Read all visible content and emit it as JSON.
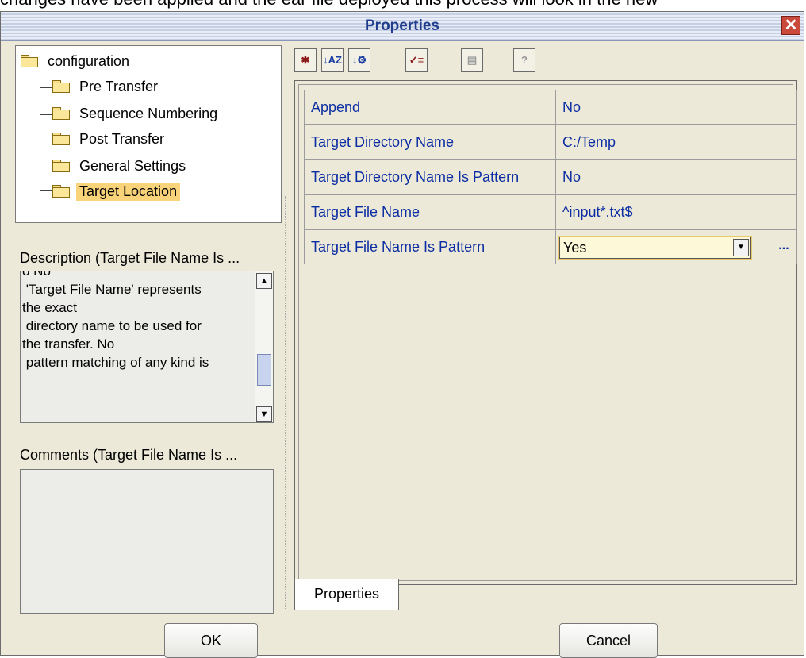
{
  "background_text": "changes have been applied and the ear file deployed this process will look in the new",
  "dialog": {
    "title": "Properties",
    "close_glyph": "✕"
  },
  "tree": {
    "root": "configuration",
    "items": [
      {
        "label": "Pre Transfer"
      },
      {
        "label": "Sequence Numbering"
      },
      {
        "label": "Post Transfer"
      },
      {
        "label": "General Settings"
      },
      {
        "label": "Target Location",
        "selected": true
      }
    ]
  },
  "description": {
    "label": "Description (Target File Name Is ...",
    "text": "o No\n 'Target File Name' represents\nthe exact\n directory name to be used for\nthe transfer. No\n pattern matching of any kind is"
  },
  "comments": {
    "label": "Comments (Target File Name Is ..."
  },
  "toolbar": {
    "buttons": [
      {
        "icon": "categorized-icon",
        "glyph": "✱"
      },
      {
        "icon": "sort-alphabetic-icon",
        "glyph": "↓AZ"
      },
      {
        "icon": "sort-by-category-icon",
        "glyph": "↓⚙"
      },
      {
        "icon": "show-modified-icon",
        "glyph": "✓≡"
      },
      {
        "icon": "property-pages-icon",
        "glyph": "▤"
      },
      {
        "icon": "help-icon",
        "glyph": "?"
      }
    ]
  },
  "properties": {
    "rows": [
      {
        "name": "Append",
        "value": "No"
      },
      {
        "name": "Target Directory Name",
        "value": "C:/Temp"
      },
      {
        "name": "Target Directory Name Is Pattern",
        "value": "No"
      },
      {
        "name": "Target File Name",
        "value": "^input*.txt$"
      },
      {
        "name": "Target File Name Is Pattern",
        "value": "Yes",
        "editor": "dropdown"
      }
    ],
    "ellipsis_label": "...",
    "tab_label": "Properties"
  },
  "buttons": {
    "ok": "OK",
    "cancel": "Cancel"
  }
}
